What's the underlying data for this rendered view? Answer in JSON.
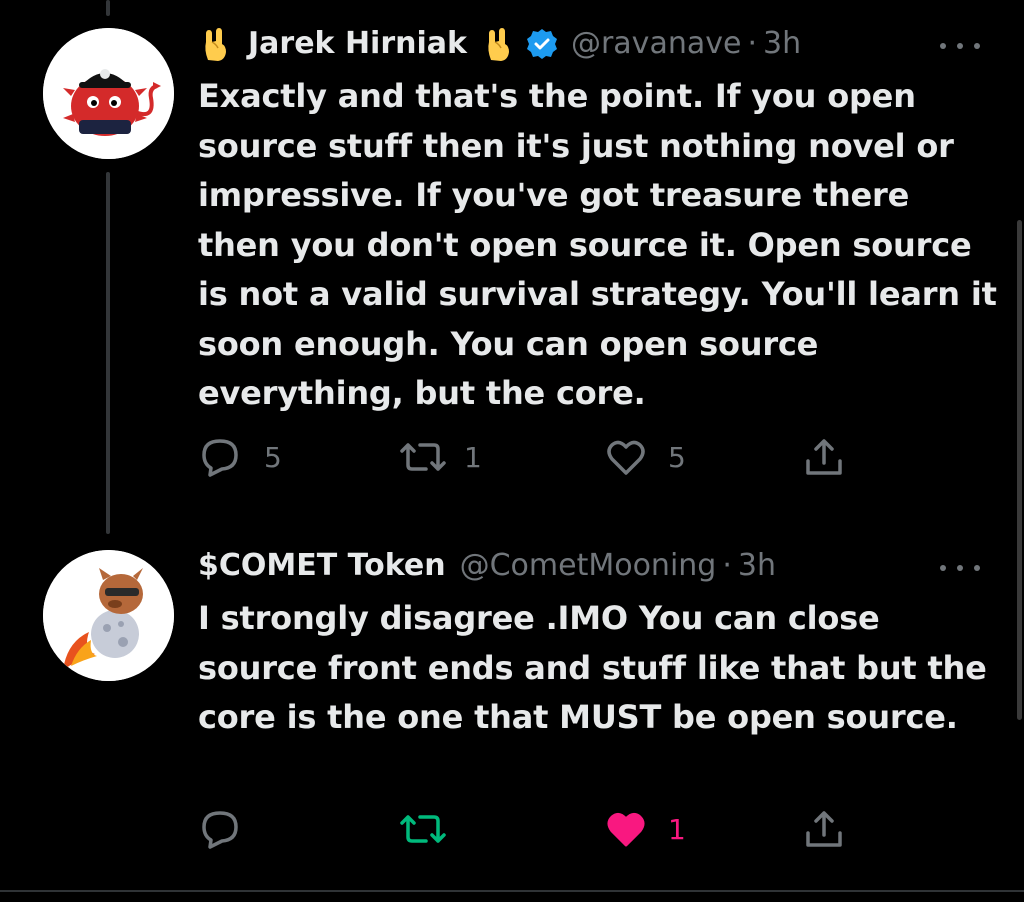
{
  "tweets": [
    {
      "display_name": "Jarek Hirniak",
      "emoji_left": "rock-hand-emoji",
      "emoji_right": "rock-hand-emoji",
      "verified": true,
      "handle": "@ravanave",
      "separator": "·",
      "time": "3h",
      "text": "Exactly and that's the point. If you open source stuff then it's just nothing novel or impressive. If you've got treasure there then you don't open source it. Open source is not a valid survival strategy. You'll learn it soon enough. You can open source everything, but the core.",
      "replies": "5",
      "retweets": "1",
      "likes": "5",
      "liked": false,
      "retweeted": false
    },
    {
      "display_name": "$COMET Token",
      "verified": false,
      "handle": "@CometMooning",
      "separator": "·",
      "time": "3h",
      "text": "I strongly disagree .IMO You can close source front ends and stuff like that but the core is the one that MUST be open source.",
      "replies": "",
      "retweets": "",
      "likes": "1",
      "liked": true,
      "retweeted": true
    }
  ],
  "icons": {
    "reply": "reply-icon",
    "retweet": "retweet-icon",
    "like": "heart-icon",
    "share": "share-icon",
    "more": "more-icon",
    "verified": "verified-badge-icon"
  },
  "colors": {
    "background": "#000000",
    "text": "#e7e9ea",
    "muted": "#71767b",
    "verified_blue": "#1d9bf0",
    "like_pink": "#f91880",
    "retweet_green": "#00ba7c",
    "avatar1_red": "#d42a2a"
  }
}
